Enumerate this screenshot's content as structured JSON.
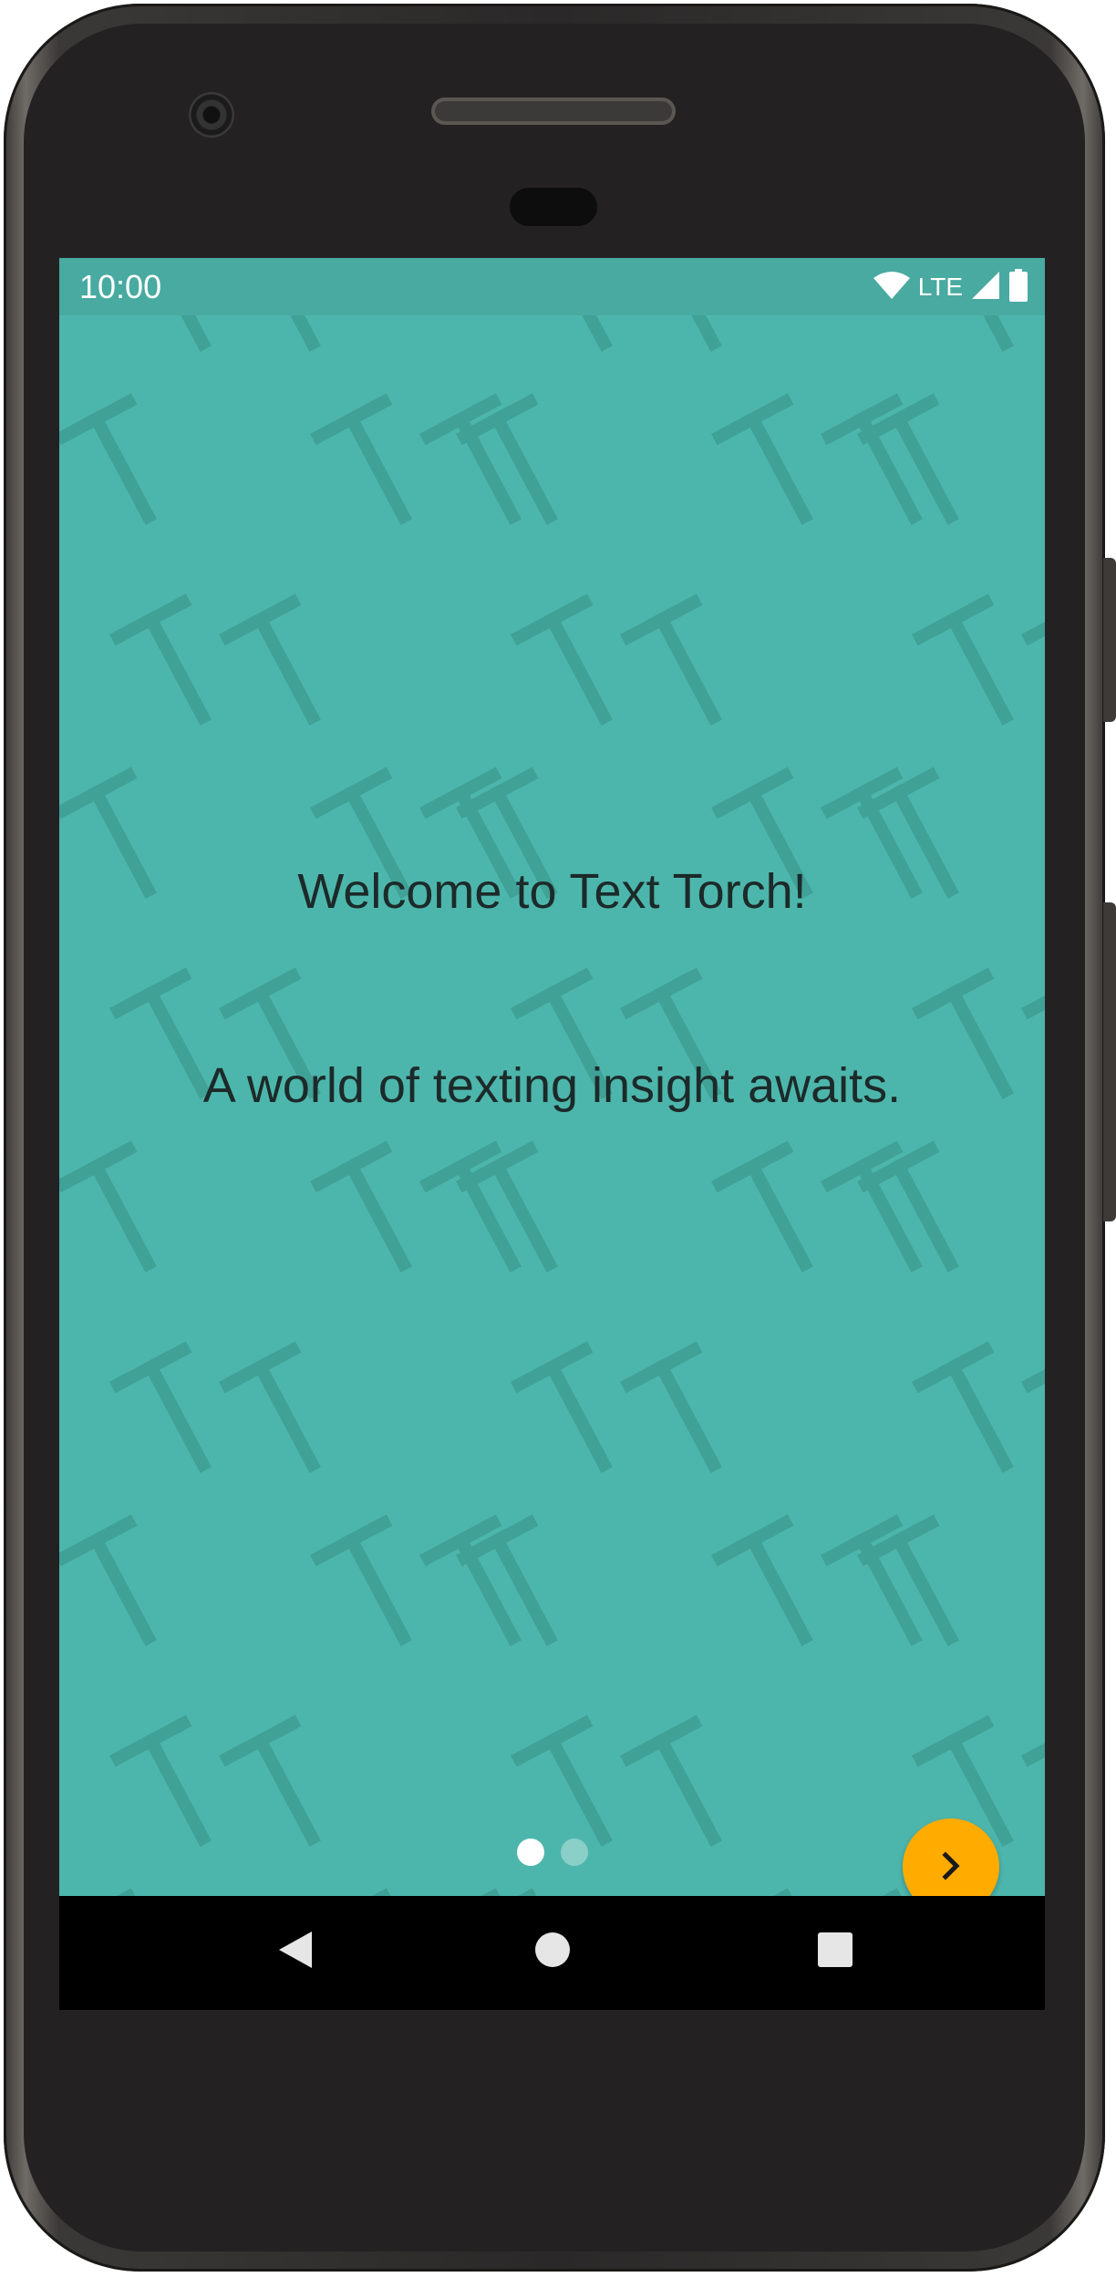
{
  "status_bar": {
    "time": "10:00",
    "network_label": "LTE",
    "icons": [
      "wifi-icon",
      "signal-icon",
      "battery-icon"
    ]
  },
  "onboarding": {
    "title": "Welcome to Text Torch!",
    "subtitle": "A world of texting insight awaits.",
    "page_count": 2,
    "current_page": 1,
    "next_button_icon": "chevron-right-icon"
  },
  "navigation_bar": {
    "icons": [
      "back-icon",
      "home-icon",
      "recents-icon"
    ]
  },
  "colors": {
    "background": "#4db6ac",
    "status_bar": "#48aaa0",
    "accent": "#ffab00",
    "pattern": "#40a197",
    "text": "#1c2a29"
  }
}
